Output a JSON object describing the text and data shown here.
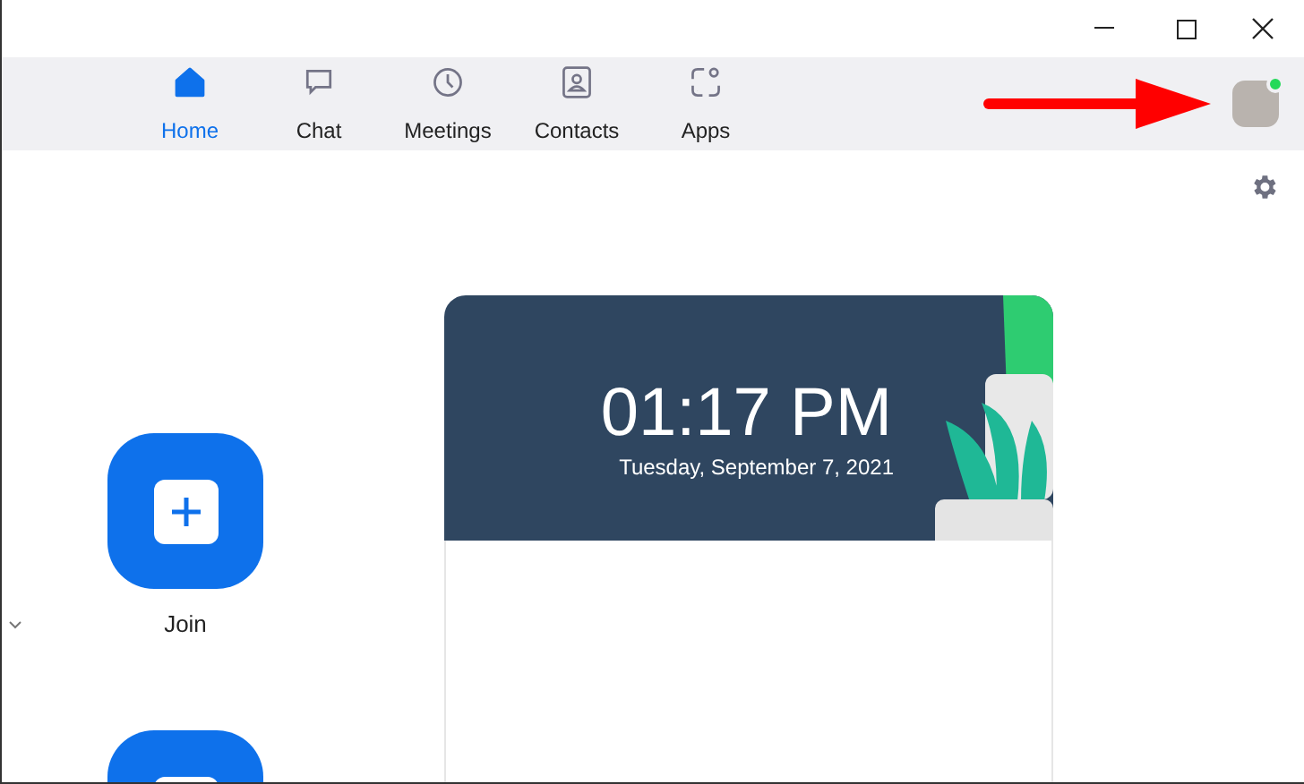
{
  "tabs": [
    {
      "label": "Home",
      "kind": "home",
      "selected": true
    },
    {
      "label": "Chat",
      "kind": "chat",
      "selected": false
    },
    {
      "label": "Meetings",
      "kind": "meetings",
      "selected": false
    },
    {
      "label": "Contacts",
      "kind": "contacts",
      "selected": false
    },
    {
      "label": "Apps",
      "kind": "apps",
      "selected": false
    }
  ],
  "profile": {
    "online": true
  },
  "actions": [
    {
      "kind": "plus_tile",
      "label": "Join"
    },
    {
      "kind": "plus_tile"
    }
  ],
  "clock_card": {
    "time": "01:17 PM",
    "date": "Tuesday, September 7, 2021"
  }
}
